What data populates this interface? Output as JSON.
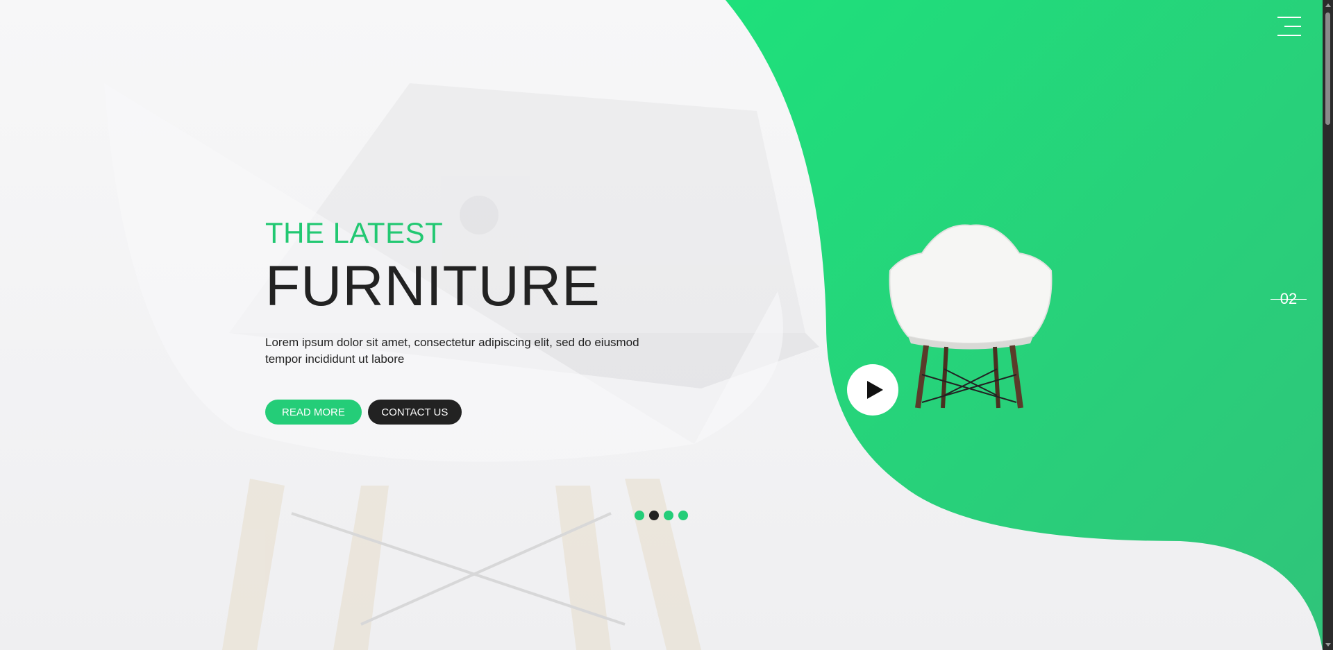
{
  "hero": {
    "subtitle": "THE LATEST",
    "title": "FURNITURE",
    "description": "Lorem ipsum dolor sit amet, consectetur adipiscing elit, sed do eiusmod tempor incididunt ut labore",
    "read_more_label": "READ MORE",
    "contact_label": "CONTACT US"
  },
  "slider": {
    "current_number": "02",
    "dots_count": 4,
    "active_dot": 2
  },
  "icons": {
    "menu": "hamburger-menu-icon",
    "play": "play-icon"
  },
  "colors": {
    "accent": "#24cd78",
    "dark": "#222222",
    "background": "#f3f3f4"
  }
}
